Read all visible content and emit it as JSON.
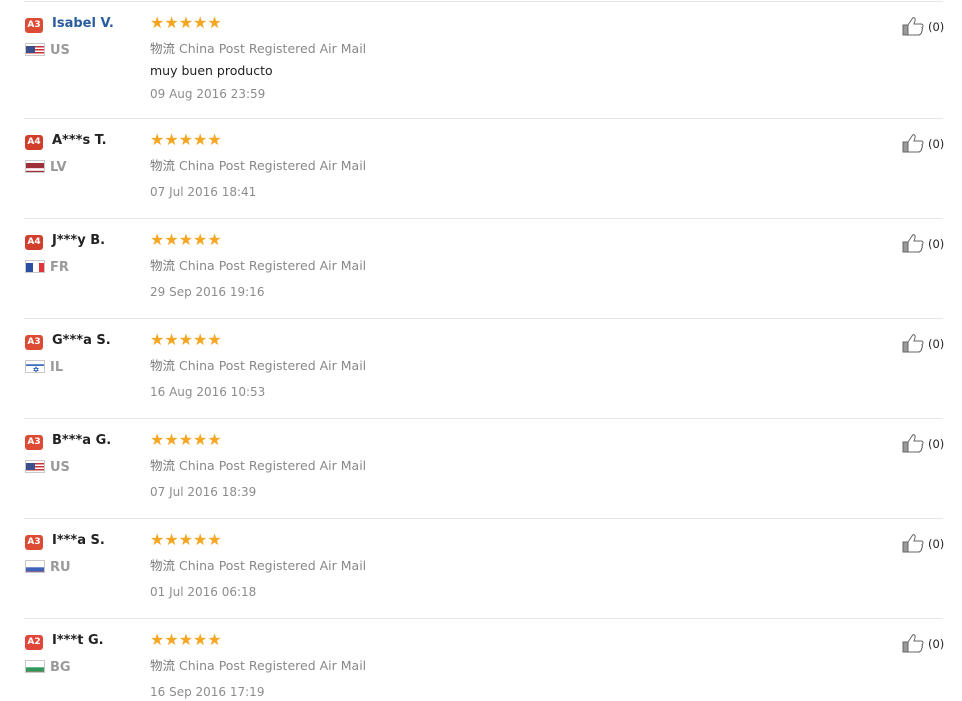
{
  "logistics_label": "物流",
  "star_glyphs": "★★★★★",
  "reviews": [
    {
      "level": "A3",
      "name": "Isabel V.",
      "country": "US",
      "flag": "us",
      "stars": 5,
      "logistics": "China Post Registered Air Mail",
      "text": "muy buen producto",
      "date": "09 Aug 2016 23:59",
      "helpful": "(0)"
    },
    {
      "level": "A4",
      "name": "A***s T.",
      "country": "LV",
      "flag": "lv",
      "stars": 5,
      "logistics": "China Post Registered Air Mail",
      "text": "",
      "date": "07 Jul 2016 18:41",
      "helpful": "(0)"
    },
    {
      "level": "A4",
      "name": "J***y B.",
      "country": "FR",
      "flag": "fr",
      "stars": 5,
      "logistics": "China Post Registered Air Mail",
      "text": "",
      "date": "29 Sep 2016 19:16",
      "helpful": "(0)"
    },
    {
      "level": "A3",
      "name": "G***a S.",
      "country": "IL",
      "flag": "il",
      "stars": 5,
      "logistics": "China Post Registered Air Mail",
      "text": "",
      "date": "16 Aug 2016 10:53",
      "helpful": "(0)"
    },
    {
      "level": "A3",
      "name": "B***a G.",
      "country": "US",
      "flag": "us",
      "stars": 5,
      "logistics": "China Post Registered Air Mail",
      "text": "",
      "date": "07 Jul 2016 18:39",
      "helpful": "(0)"
    },
    {
      "level": "A3",
      "name": "I***a S.",
      "country": "RU",
      "flag": "ru",
      "stars": 5,
      "logistics": "China Post Registered Air Mail",
      "text": "",
      "date": "01 Jul 2016 06:18",
      "helpful": "(0)"
    },
    {
      "level": "A2",
      "name": "I***t G.",
      "country": "BG",
      "flag": "bg",
      "stars": 5,
      "logistics": "China Post Registered Air Mail",
      "text": "",
      "date": "16 Sep 2016 17:19",
      "helpful": "(0)"
    }
  ],
  "colors": {
    "star": "#f5a623",
    "badge": "#dd4b34",
    "name_link": "#2a5d9f"
  },
  "icons": {
    "helpful": "thumbs-up-icon",
    "rating": "star-icon"
  }
}
